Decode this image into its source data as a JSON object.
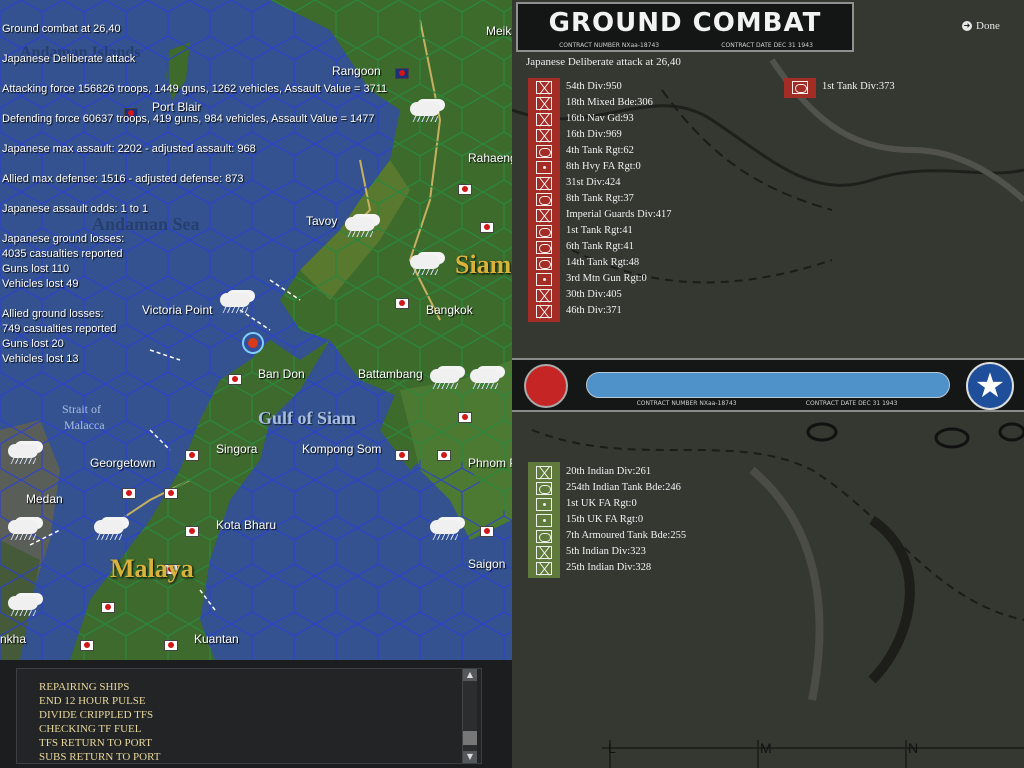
{
  "map": {
    "report": [
      "Ground combat at 26,40",
      "",
      "Japanese Deliberate attack",
      "",
      "Attacking force 156826 troops, 1449 guns, 1262 vehicles, Assault Value = 3711",
      "",
      "Defending force 60637 troops, 419 guns, 984 vehicles, Assault Value = 1477",
      "",
      "Japanese max assault: 2202 - adjusted assault: 968",
      "",
      "Allied max defense: 1516 - adjusted defense: 873",
      "",
      "Japanese assault odds: 1 to 1",
      "",
      "Japanese ground losses:",
      "4035 casualties reported",
      "Guns lost 110",
      "Vehicles lost 49",
      "",
      "Allied ground losses:",
      "749 casualties reported",
      "Guns lost 20",
      "Vehicles lost 13"
    ],
    "places": {
      "rangoon": "Rangoon",
      "port_blair": "Port Blair",
      "rahaeng": "Rahaeng",
      "tavoy": "Tavoy",
      "victoria_point": "Victoria Point",
      "bangkok": "Bangkok",
      "ban_don": "Ban Don",
      "battambang": "Battambang",
      "singora": "Singora",
      "kompong_som": "Kompong Som",
      "georgetown": "Georgetown",
      "medan": "Medan",
      "kota_bharu": "Kota Bharu",
      "kuantan": "Kuantan",
      "phnom": "Phnom P",
      "saigon": "Saigon",
      "meik": "Meik",
      "nkha": "nkha"
    },
    "regions": {
      "andaman_islands": "Andaman Islands",
      "andaman_sea": "Andaman Sea",
      "siam": "Siam",
      "gulf_of_siam": "Gulf of Siam",
      "strait_line1": "Strait of",
      "strait_line2": "Malacca",
      "malaya": "Malaya"
    }
  },
  "log": {
    "lines": [
      "REPAIRING SHIPS",
      "END 12 HOUR PULSE",
      "DIVIDE CRIPPLED TFS",
      "CHECKING TF FUEL",
      "TFS RETURN TO PORT",
      "SUBS RETURN TO PORT"
    ]
  },
  "combat": {
    "title": "GROUND COMBAT",
    "contract_number": "CONTRACT NUMBER   NXaa-18743",
    "contract_date": "CONTRACT DATE  DEC 31 1943",
    "done_label": "Done",
    "subtitle": "Japanese Deliberate attack at 26,40",
    "japanese_units": [
      {
        "name": "54th Div:950",
        "symbol": "inf"
      },
      {
        "name": "18th Mixed Bde:306",
        "symbol": "inf"
      },
      {
        "name": "16th Nav Gd:93",
        "symbol": "inf"
      },
      {
        "name": "16th Div:969",
        "symbol": "inf"
      },
      {
        "name": "4th Tank Rgt:62",
        "symbol": "arm"
      },
      {
        "name": "8th Hvy FA Rgt:0",
        "symbol": "art"
      },
      {
        "name": "31st Div:424",
        "symbol": "inf"
      },
      {
        "name": "8th Tank Rgt:37",
        "symbol": "arm"
      },
      {
        "name": "Imperial Guards Div:417",
        "symbol": "inf"
      },
      {
        "name": "1st Tank Rgt:41",
        "symbol": "arm"
      },
      {
        "name": "6th Tank Rgt:41",
        "symbol": "arm"
      },
      {
        "name": "14th Tank Rgt:48",
        "symbol": "arm"
      },
      {
        "name": "3rd Mtn Gun Rgt:0",
        "symbol": "art"
      },
      {
        "name": "30th Div:405",
        "symbol": "inf"
      },
      {
        "name": "46th Div:371",
        "symbol": "inf"
      }
    ],
    "japanese_reserve": [
      {
        "name": "1st Tank Div:373",
        "symbol": "arm"
      }
    ],
    "allied_units": [
      {
        "name": "20th Indian Div:261",
        "symbol": "inf"
      },
      {
        "name": "254th Indian Tank Bde:246",
        "symbol": "arm"
      },
      {
        "name": "1st UK FA Rgt:0",
        "symbol": "art"
      },
      {
        "name": "15th UK FA Rgt:0",
        "symbol": "art"
      },
      {
        "name": "7th Armoured Tank Bde:255",
        "symbol": "arm"
      },
      {
        "name": "5th Indian Div:323",
        "symbol": "inf"
      },
      {
        "name": "25th Indian Div:328",
        "symbol": "inf"
      }
    ],
    "grid_letters": [
      "L",
      "M",
      "N"
    ],
    "colors": {
      "japan": "#b0302a",
      "allied": "#5f7a3a",
      "allied_disc": "#1f4f9a"
    },
    "icons": {
      "japan": "rising-sun-disc-icon",
      "allied": "white-star-icon",
      "done": "arrow-right-icon"
    }
  }
}
